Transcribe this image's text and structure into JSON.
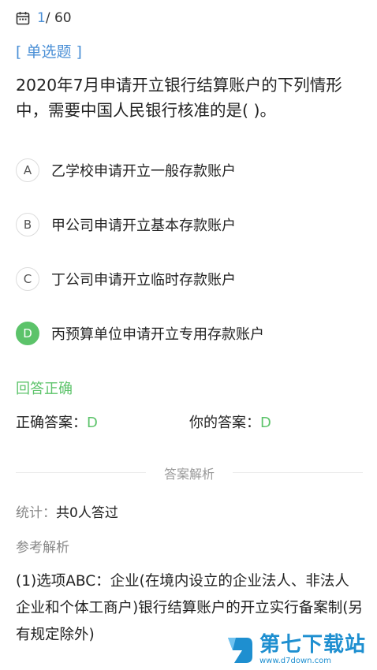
{
  "header": {
    "calendar_icon": "calendar-icon",
    "current": "1",
    "total": "/ 60"
  },
  "question": {
    "type": "[ 单选题 ]",
    "text": "2020年7月申请开立银行结算账户的下列情形中，需要中国人民银行核准的是(    )。",
    "options": [
      {
        "letter": "A",
        "text": "乙学校申请开立一般存款账户",
        "selected": false
      },
      {
        "letter": "B",
        "text": "甲公司申请开立基本存款账户",
        "selected": false
      },
      {
        "letter": "C",
        "text": "丁公司申请开立临时存款账户",
        "selected": false
      },
      {
        "letter": "D",
        "text": "丙预算单位申请开立专用存款账户",
        "selected": true
      }
    ]
  },
  "result": {
    "status": "回答正确",
    "correct_label": "正确答案：",
    "correct_value": "D",
    "yours_label": "你的答案：",
    "yours_value": "D"
  },
  "analysis": {
    "section_title": "答案解析",
    "stats_label": "统计：",
    "stats_value": "共0人答过",
    "reference_title": "参考解析",
    "text": "(1)选项ABC：企业(在境内设立的企业法人、非法人企业和个体工商户)银行结算账户的开立实行备案制(另有规定除外)"
  },
  "watermark": {
    "name": "第七下载站",
    "url": "www.d7down.com"
  },
  "colors": {
    "accent_blue": "#4a8fd6",
    "success_green": "#5cc36a",
    "watermark_blue": "#1e8fd0"
  }
}
